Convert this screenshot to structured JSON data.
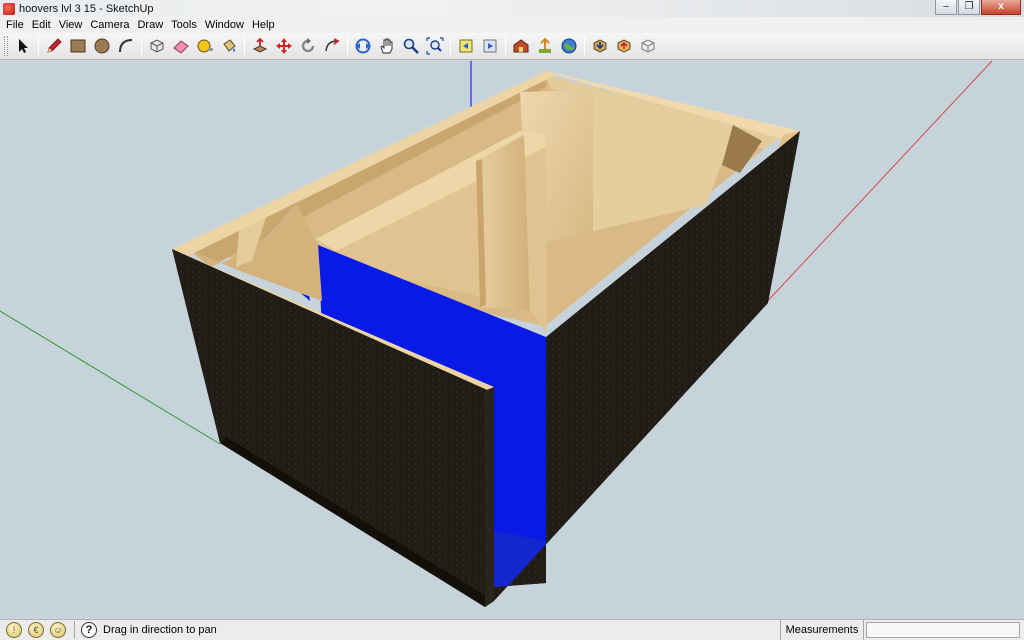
{
  "window": {
    "title": "hoovers lvl 3 15 - SketchUp",
    "minimize_glyph": "–",
    "restore_glyph": "❐",
    "close_glyph": "x"
  },
  "menu": [
    "File",
    "Edit",
    "View",
    "Camera",
    "Draw",
    "Tools",
    "Window",
    "Help"
  ],
  "toolbar": {
    "tools": [
      {
        "name": "select-tool",
        "icon": "arrow-icon"
      },
      {
        "name": "line-tool",
        "icon": "pencil-icon"
      },
      {
        "name": "rectangle-tool",
        "icon": "rectangle-icon"
      },
      {
        "name": "circle-tool",
        "icon": "circle-icon"
      },
      {
        "name": "arc-tool",
        "icon": "arc-icon"
      },
      {
        "name": "make-component-tool",
        "icon": "component-icon"
      },
      {
        "name": "eraser-tool",
        "icon": "eraser-icon"
      },
      {
        "name": "tape-measure-tool",
        "icon": "tape-measure-icon"
      },
      {
        "name": "paint-bucket-tool",
        "icon": "paint-bucket-icon"
      },
      {
        "name": "push-pull-tool",
        "icon": "push-pull-icon"
      },
      {
        "name": "move-tool",
        "icon": "move-icon"
      },
      {
        "name": "rotate-tool",
        "icon": "rotate-icon"
      },
      {
        "name": "follow-me-tool",
        "icon": "follow-me-icon"
      },
      {
        "name": "orbit-tool",
        "icon": "orbit-icon"
      },
      {
        "name": "pan-tool",
        "icon": "hand-icon"
      },
      {
        "name": "zoom-tool",
        "icon": "magnifier-icon"
      },
      {
        "name": "zoom-extents-tool",
        "icon": "zoom-extents-icon"
      },
      {
        "name": "previous-view-tool",
        "icon": "previous-view-icon"
      },
      {
        "name": "next-view-tool",
        "icon": "next-view-icon"
      },
      {
        "name": "get-models-tool",
        "icon": "warehouse-icon"
      },
      {
        "name": "share-model-tool",
        "icon": "share-model-icon"
      },
      {
        "name": "google-earth-tool",
        "icon": "earth-icon"
      },
      {
        "name": "get-components-tool",
        "icon": "get-components-icon"
      },
      {
        "name": "share-component-tool",
        "icon": "share-component-icon"
      },
      {
        "name": "extension-warehouse-tool",
        "icon": "extension-icon"
      }
    ]
  },
  "colors": {
    "viewport_bg": "#c7d3db",
    "wood": "#e2c89a",
    "carpet": "#1e1a14",
    "blue_face": "#0a1ae6",
    "axis_red": "#d44a4a",
    "axis_green": "#2e9a2e",
    "axis_blue": "#2a2ad8"
  },
  "status": {
    "message": "Drag in direction to pan",
    "help_glyph": "?",
    "measurements_label": "Measurements",
    "measurements_value": ""
  }
}
